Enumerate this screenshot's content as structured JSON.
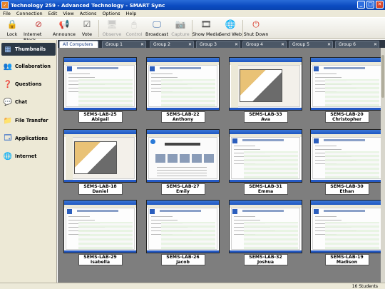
{
  "window": {
    "title": "Technology 259 - Advanced Technology - SMART Sync",
    "minimize": "_",
    "maximize": "□",
    "close": "✕"
  },
  "menu": [
    "File",
    "Connection",
    "Edit",
    "View",
    "Actions",
    "Options",
    "Help"
  ],
  "toolbar": {
    "items": [
      {
        "label": "Lock",
        "icon": "lock-icon",
        "enabled": true
      },
      {
        "label": "Internet Block",
        "icon": "internet-block-icon",
        "enabled": true
      },
      {
        "label": "Announce",
        "icon": "announce-icon",
        "enabled": true
      },
      {
        "label": "Vote",
        "icon": "vote-icon",
        "enabled": true
      },
      {
        "label": "Observe",
        "icon": "observe-icon",
        "enabled": false
      },
      {
        "label": "Control",
        "icon": "control-icon",
        "enabled": false
      },
      {
        "label": "Broadcast",
        "icon": "broadcast-icon",
        "enabled": true
      },
      {
        "label": "Capture",
        "icon": "capture-icon",
        "enabled": false
      },
      {
        "label": "Show Media",
        "icon": "show-media-icon",
        "enabled": true
      },
      {
        "label": "Send Web",
        "icon": "send-web-icon",
        "enabled": true
      },
      {
        "label": "Shut Down",
        "icon": "shut-down-icon",
        "enabled": true
      }
    ]
  },
  "sidebar": {
    "items": [
      {
        "label": "Thumbnails",
        "icon": "thumbnails-icon",
        "active": true
      },
      {
        "label": "Collaboration",
        "icon": "collaboration-icon",
        "active": false
      },
      {
        "label": "Questions",
        "icon": "questions-icon",
        "active": false
      },
      {
        "label": "Chat",
        "icon": "chat-icon",
        "active": false
      },
      {
        "label": "File Transfer",
        "icon": "file-transfer-icon",
        "active": false
      },
      {
        "label": "Applications",
        "icon": "applications-icon",
        "active": false
      },
      {
        "label": "Internet",
        "icon": "internet-icon",
        "active": false
      }
    ]
  },
  "tabs": [
    "All Computers",
    "Group 1",
    "Group 2",
    "Group 3",
    "Group 4",
    "Group 5",
    "Group 6"
  ],
  "students": [
    {
      "computer": "SEMS-LAB-25",
      "name": "Abigail",
      "screen": "doc"
    },
    {
      "computer": "SEMS-LAB-22",
      "name": "Anthony",
      "screen": "doc"
    },
    {
      "computer": "SEMS-LAB-33",
      "name": "Ava",
      "screen": "sketch"
    },
    {
      "computer": "SEMS-LAB-20",
      "name": "Christopher",
      "screen": "doc"
    },
    {
      "computer": "SEMS-LAB-18",
      "name": "Daniel",
      "screen": "sketch"
    },
    {
      "computer": "SEMS-LAB-27",
      "name": "Emily",
      "screen": "web"
    },
    {
      "computer": "SEMS-LAB-31",
      "name": "Emma",
      "screen": "doc"
    },
    {
      "computer": "SEMS-LAB-30",
      "name": "Ethan",
      "screen": "doc"
    },
    {
      "computer": "SEMS-LAB-29",
      "name": "Isabella",
      "screen": "doc"
    },
    {
      "computer": "SEMS-LAB-26",
      "name": "Jacob",
      "screen": "doc"
    },
    {
      "computer": "SEMS-LAB-32",
      "name": "Joshua",
      "screen": "doc"
    },
    {
      "computer": "SEMS-LAB-19",
      "name": "Madison",
      "screen": "doc"
    }
  ],
  "status": {
    "count": "16 Students"
  }
}
